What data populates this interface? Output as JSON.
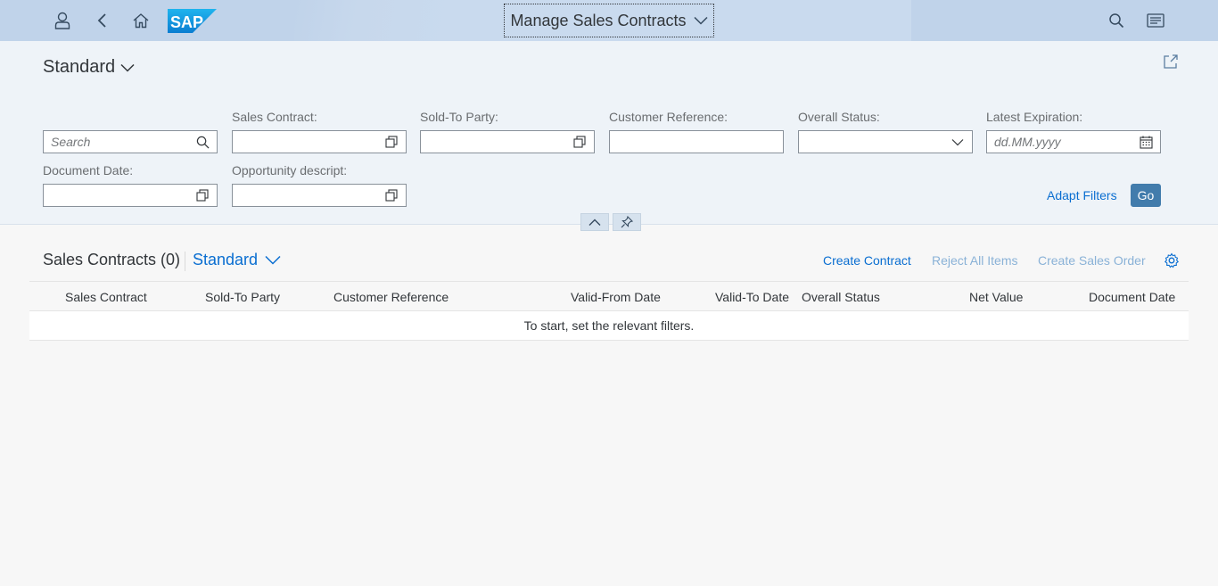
{
  "shell": {
    "app_title": "Manage Sales Contracts",
    "logo_text": "SAP",
    "icons": [
      "user-icon",
      "back-icon",
      "home-icon",
      "search-icon",
      "notifications-icon"
    ]
  },
  "filter_bar": {
    "variant": "Standard",
    "search_placeholder": "Search",
    "filters": {
      "sales_contract": {
        "label": "Sales Contract:"
      },
      "sold_to_party": {
        "label": "Sold-To Party:"
      },
      "customer_reference": {
        "label": "Customer Reference:"
      },
      "overall_status": {
        "label": "Overall Status:"
      },
      "latest_expiration": {
        "label": "Latest Expiration:",
        "placeholder": "dd.MM.yyyy"
      },
      "document_date": {
        "label": "Document Date:"
      },
      "opportunity_description": {
        "label": "Opportunity descript:"
      }
    },
    "adapt_filters": "Adapt Filters",
    "go": "Go"
  },
  "table": {
    "title": "Sales Contracts (0)",
    "variant": "Standard",
    "actions": {
      "create_contract": "Create Contract",
      "reject_all_items": "Reject All Items",
      "create_sales_order": "Create Sales Order"
    },
    "columns": [
      "Sales Contract",
      "Sold-To Party",
      "Customer Reference",
      "Valid-From Date",
      "Valid-To Date",
      "Overall Status",
      "Net Value",
      "Document Date"
    ],
    "no_data_text": "To start, set the relevant filters."
  },
  "colors": {
    "shell_bg": "#c0d3ea",
    "filterbar_bg": "#eef3f8",
    "link": "#0a6ed1",
    "go_button": "#427cac"
  }
}
